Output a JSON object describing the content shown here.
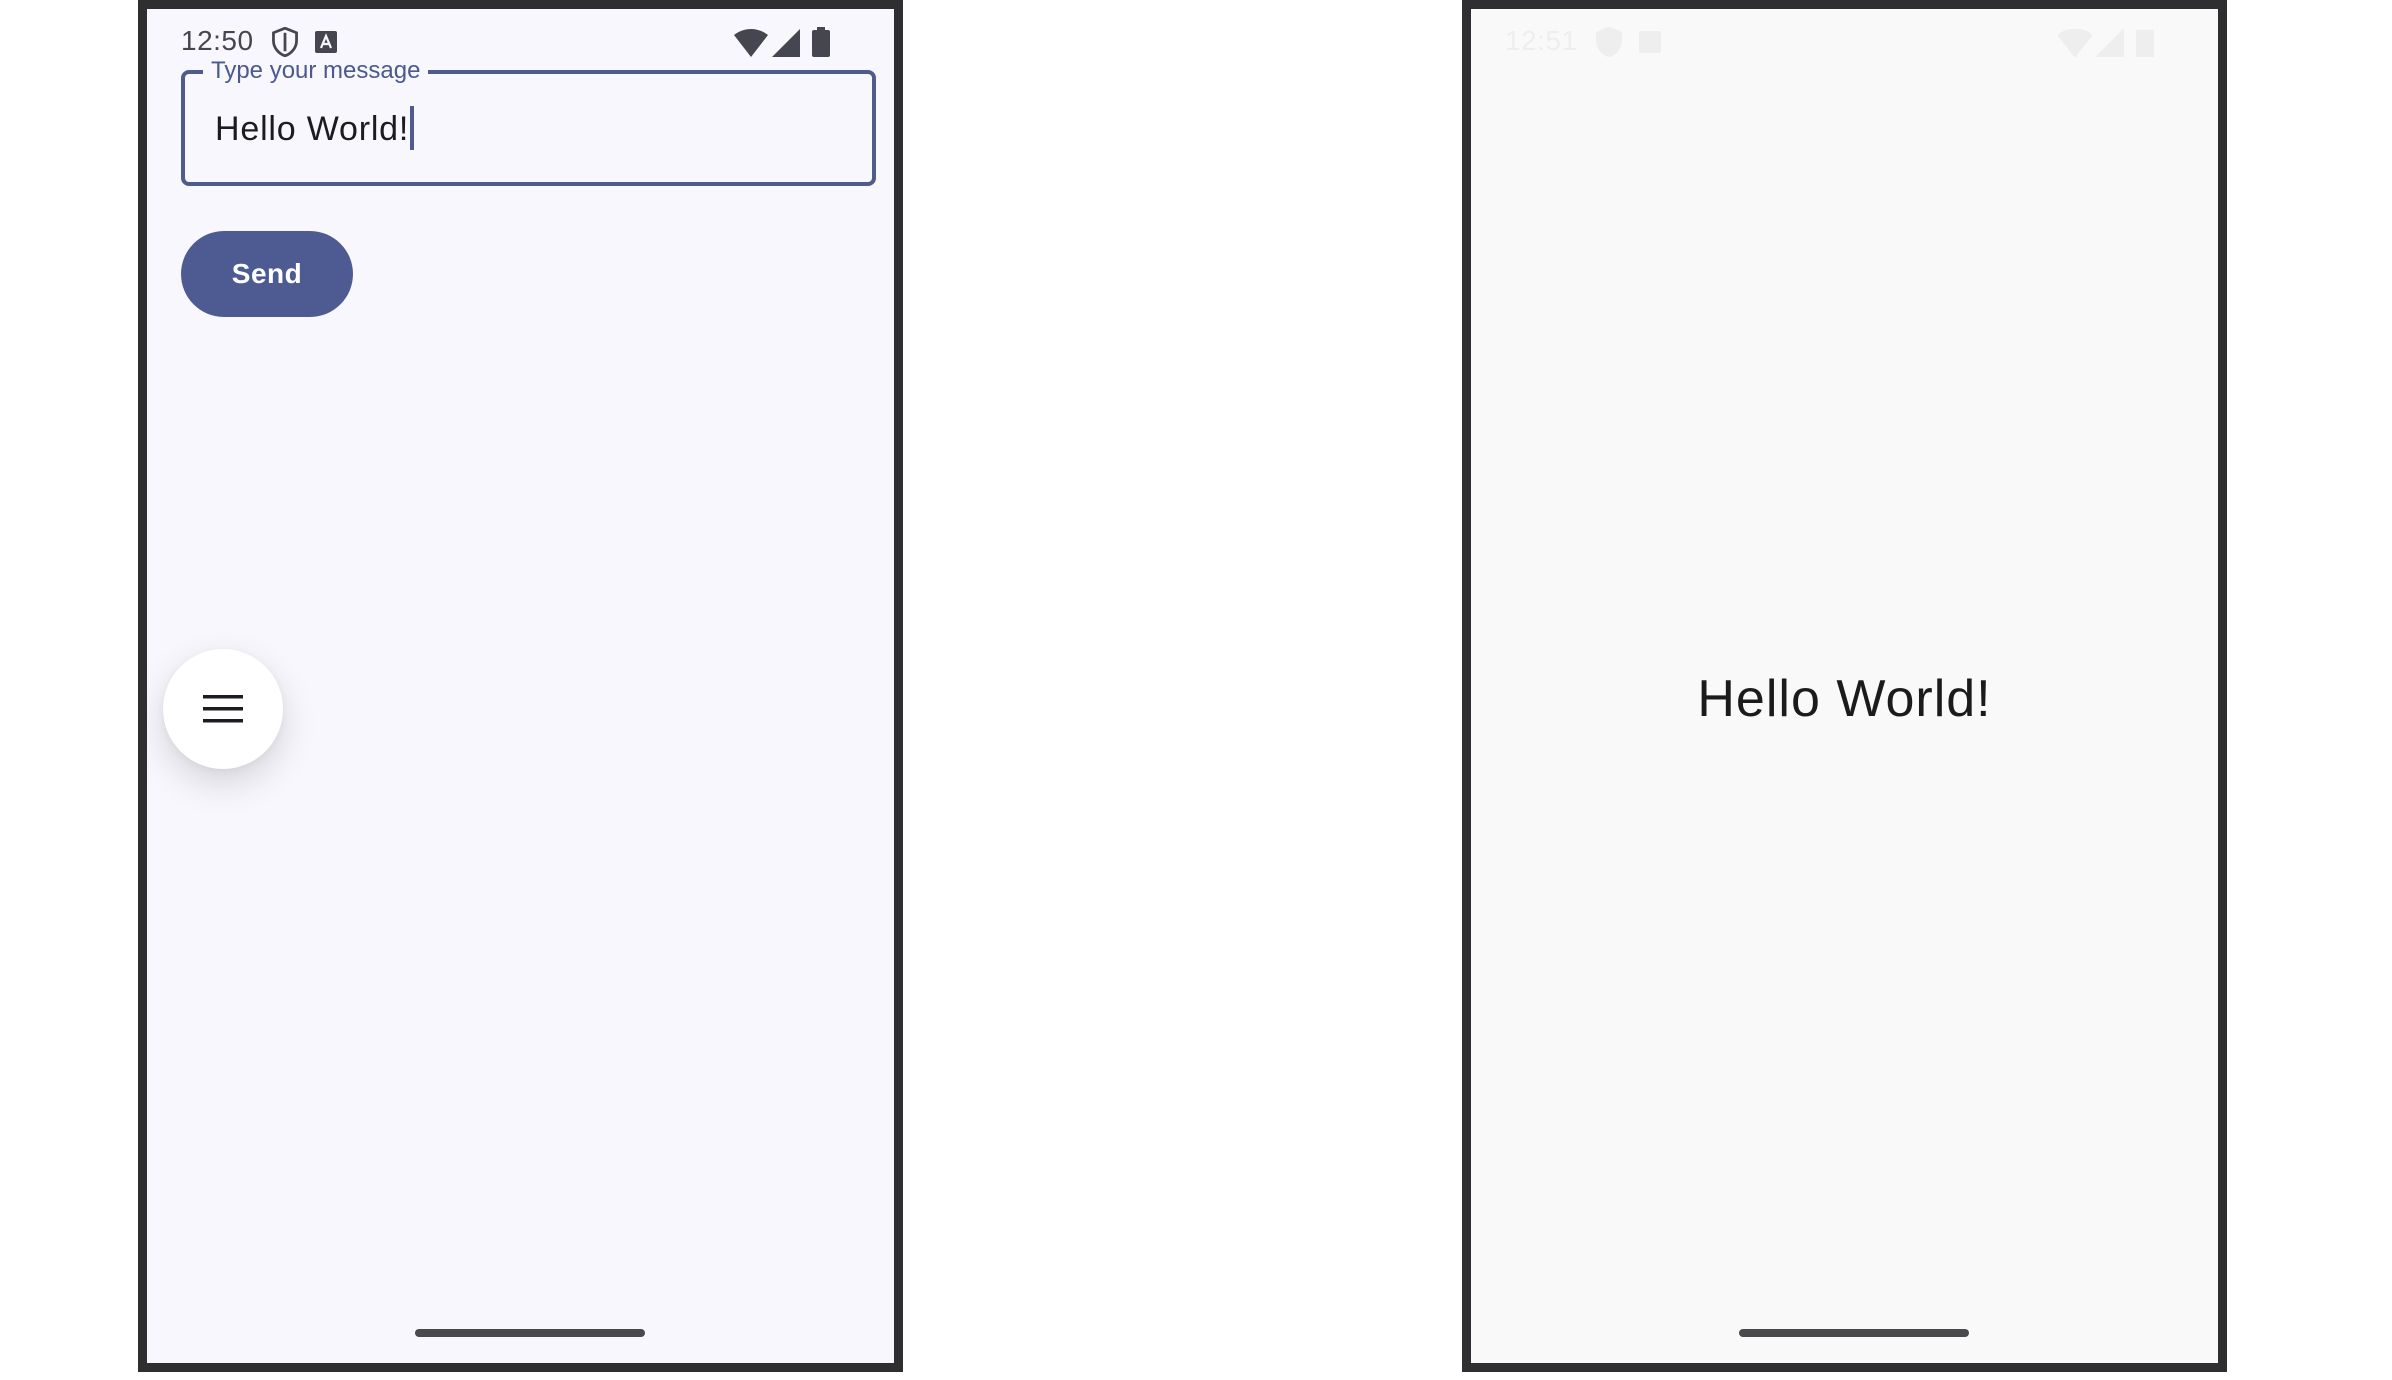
{
  "left_screen": {
    "status_bar": {
      "time": "12:50",
      "icons": [
        "shield-icon",
        "keyboard-a-icon",
        "wifi-icon",
        "signal-icon",
        "battery-icon"
      ]
    },
    "message_field": {
      "label": "Type your message",
      "value": "Hello World!"
    },
    "send_button": {
      "label": "Send"
    },
    "menu_button": {
      "icon": "menu-icon"
    }
  },
  "right_screen": {
    "status_bar": {
      "time": "12:51",
      "icons": [
        "shield-icon",
        "keyboard-a-icon",
        "wifi-icon",
        "signal-icon",
        "battery-icon"
      ]
    },
    "message_display": "Hello World!"
  },
  "colors": {
    "accent": "#4d5b92",
    "left_background": "#f8f7fd",
    "right_background": "#f9f9f9",
    "frame": "#2f2f31"
  }
}
